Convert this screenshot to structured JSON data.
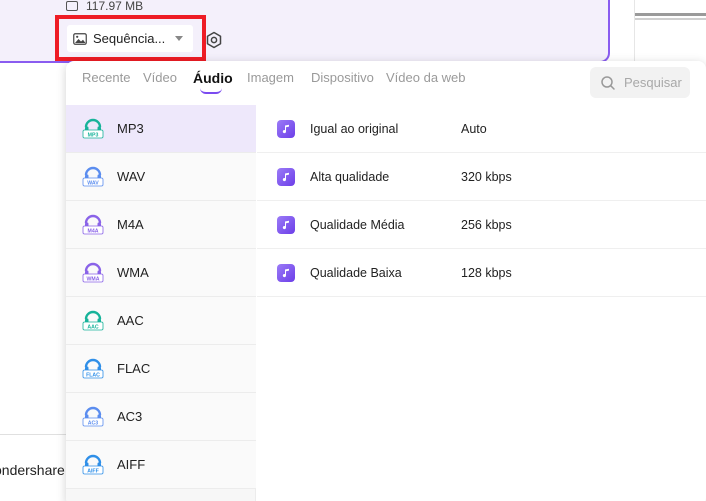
{
  "file": {
    "size": "117.97 MB",
    "format_label": "Sequência...",
    "brand_partial": "ondershare"
  },
  "tabs": [
    {
      "label": "Recente",
      "active": false
    },
    {
      "label": "Vídeo",
      "active": false
    },
    {
      "label": "Áudio",
      "active": true
    },
    {
      "label": "Imagem",
      "active": false
    },
    {
      "label": "Dispositivo",
      "active": false
    },
    {
      "label": "Vídeo da web",
      "active": false
    }
  ],
  "search": {
    "placeholder": "Pesquisar"
  },
  "formats": [
    {
      "label": "MP3",
      "badge": "MP3",
      "color": "#17b39a",
      "selected": true
    },
    {
      "label": "WAV",
      "badge": "WAV",
      "color": "#5b8def",
      "selected": false
    },
    {
      "label": "M4A",
      "badge": "M4A",
      "color": "#8a63e8",
      "selected": false
    },
    {
      "label": "WMA",
      "badge": "WMA",
      "color": "#8a63e8",
      "selected": false
    },
    {
      "label": "AAC",
      "badge": "AAC",
      "color": "#17b39a",
      "selected": false
    },
    {
      "label": "FLAC",
      "badge": "FLAC",
      "color": "#2f8fe8",
      "selected": false
    },
    {
      "label": "AC3",
      "badge": "AC3",
      "color": "#5b8def",
      "selected": false
    },
    {
      "label": "AIFF",
      "badge": "AIFF",
      "color": "#2f8fe8",
      "selected": false
    }
  ],
  "qualities": [
    {
      "name": "Igual ao original",
      "value": "Auto"
    },
    {
      "name": "Alta qualidade",
      "value": "320 kbps"
    },
    {
      "name": "Qualidade Média",
      "value": "256 kbps"
    },
    {
      "name": "Qualidade Baixa",
      "value": "128 kbps"
    }
  ],
  "colors": {
    "accent": "#7b4bf0",
    "highlight_border": "#ee1c25",
    "selected_row": "#eee8fb"
  }
}
